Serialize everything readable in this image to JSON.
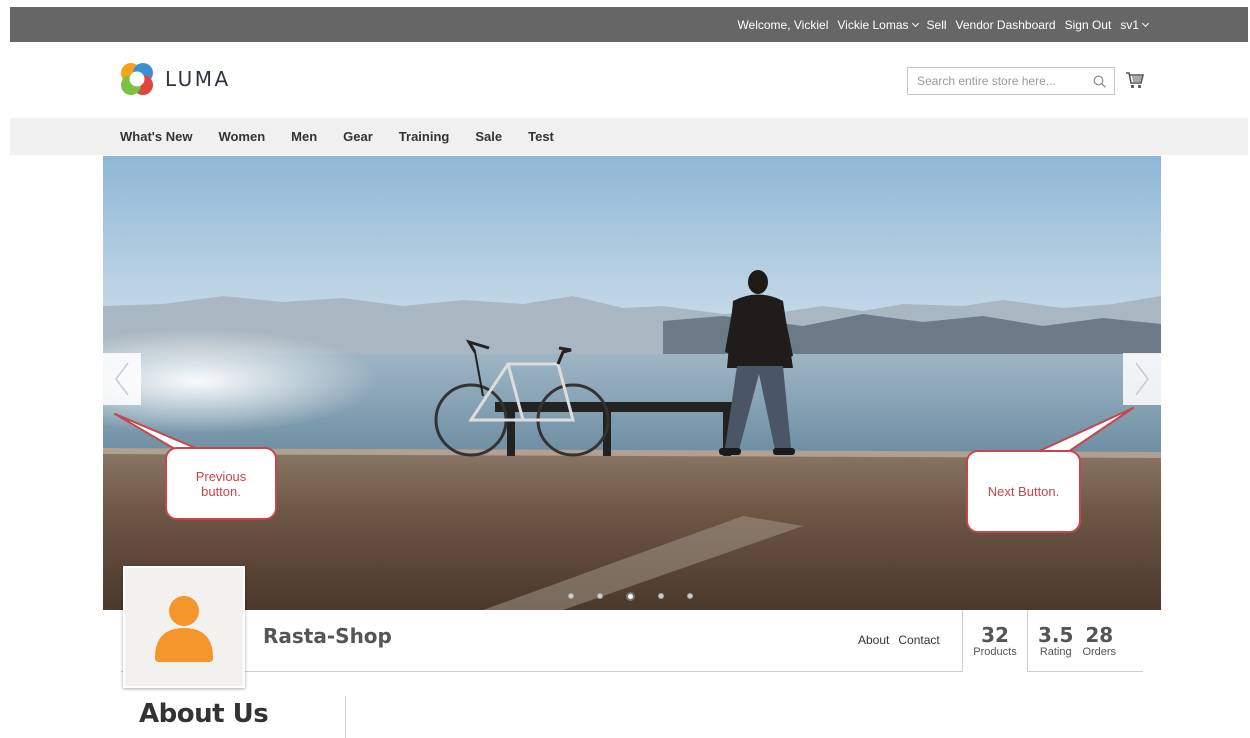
{
  "top_bar": {
    "welcome": "Welcome, Vickiel",
    "account": "Vickie Lomas",
    "sell": "Sell",
    "vendor_dashboard": "Vendor Dashboard",
    "sign_out": "Sign Out",
    "store_switcher": "sv1"
  },
  "header": {
    "logo_text": "LUMA",
    "search_placeholder": "Search entire store here...",
    "icons": [
      "search-icon",
      "cart-icon"
    ]
  },
  "nav": {
    "items": [
      "What's New",
      "Women",
      "Men",
      "Gear",
      "Training",
      "Sale",
      "Test"
    ]
  },
  "banner": {
    "slide_count": 5,
    "active_slide_index": 2,
    "icons": [
      "chevron-left-icon",
      "chevron-right-icon"
    ]
  },
  "annotations": {
    "previous_line1": "Previous",
    "previous_line2": "button.",
    "next": "Next Button."
  },
  "profile": {
    "shop_name": "Rasta-Shop",
    "links": [
      "About",
      "Contact"
    ],
    "stats": {
      "products_value": "32",
      "products_label": "Products",
      "rating_value": "3.5",
      "rating_label": "Rating",
      "orders_value": "28",
      "orders_label": "Orders"
    },
    "avatar_icon": "user-avatar-icon"
  },
  "about": {
    "title": "About Us"
  },
  "colors": {
    "top_bar_bg": "#676666",
    "nav_bg": "#f0f0f0",
    "callout_red": "#c8454a",
    "avatar_orange": "#f5962d"
  }
}
